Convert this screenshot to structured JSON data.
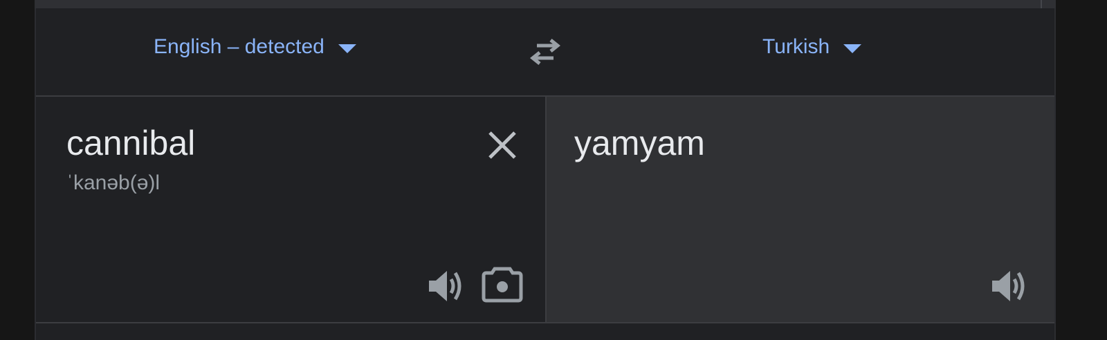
{
  "lang_bar": {
    "source_language": "English – detected",
    "target_language": "Turkish"
  },
  "source": {
    "text": "cannibal",
    "phonetic": "ˈkanəb(ə)l"
  },
  "target": {
    "text": "yamyam"
  },
  "icons": {
    "dropdown": "caret-down-icon",
    "swap": "swap-arrows-icon",
    "clear": "close-icon",
    "listen": "speaker-icon",
    "camera": "camera-icon"
  },
  "colors": {
    "accent": "#8ab4f8",
    "background": "#202124",
    "target_panel": "#303134",
    "text_primary": "#e8eaed",
    "text_secondary": "#9aa0a6"
  }
}
